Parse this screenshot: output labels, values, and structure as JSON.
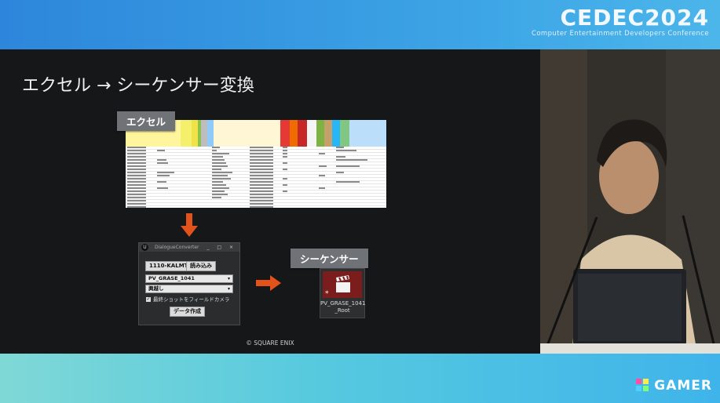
{
  "event": {
    "logo": "CEDEC2024",
    "subtitle": "Computer Entertainment Developers Conference"
  },
  "slide": {
    "title": "エクセル → シーケンサー変換",
    "excel_label": "エクセル",
    "sequencer_label": "シーケンサー",
    "copyright": "© SQUARE ENIX"
  },
  "converter": {
    "window_title": "DialogueConverter",
    "version_dropdown": "1110-KALMT",
    "load_button": "読み込み",
    "asset_dropdown": "PV_GRASE_1041",
    "option_dropdown": "興越し",
    "checkbox_label": "最終ショットをフィールドカメラ",
    "checkbox_checked": true,
    "create_button": "データ作成"
  },
  "sequencer_asset": {
    "name": "PV_GRASE_1041\n_Root"
  },
  "brand": {
    "site": "GAMER"
  },
  "colors": {
    "arrow": "#e4521b",
    "accent_top": "#2d86db",
    "accent_bottom": "#56c9df"
  }
}
